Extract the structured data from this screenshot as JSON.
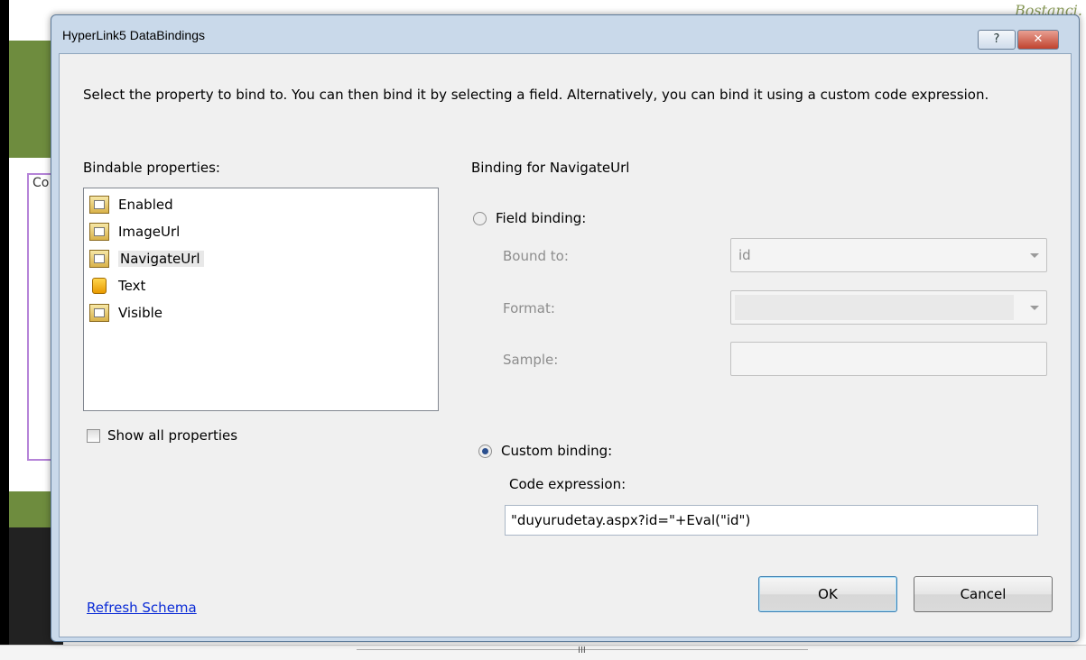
{
  "background": {
    "brand_fragment": "Bostanci.",
    "panel_fragment": "Co",
    "scroll_grip": "III"
  },
  "dialog": {
    "title": "HyperLink5 DataBindings",
    "help_glyph": "?",
    "close_glyph": "✕",
    "intro": "Select the property to bind to. You can then bind it by selecting a field. Alternatively, you can bind it using a custom code expression.",
    "bindable_label": "Bindable properties:",
    "properties": [
      {
        "label": "Enabled",
        "icon": "property-icon"
      },
      {
        "label": "ImageUrl",
        "icon": "property-icon"
      },
      {
        "label": "NavigateUrl",
        "icon": "property-icon",
        "selected": true
      },
      {
        "label": "Text",
        "icon": "field-icon"
      },
      {
        "label": "Visible",
        "icon": "property-icon"
      }
    ],
    "show_all_label": "Show all properties",
    "binding_for": "Binding for NavigateUrl",
    "field_binding_label": "Field binding:",
    "bound_to_label": "Bound to:",
    "bound_to_value": "id",
    "format_label": "Format:",
    "format_value": "",
    "sample_label": "Sample:",
    "custom_binding_label": "Custom binding:",
    "code_expression_label": "Code expression:",
    "code_expression_value": "\"duyurudetay.aspx?id=\"+Eval(\"id\")",
    "refresh_link": "Refresh Schema",
    "ok_label": "OK",
    "cancel_label": "Cancel"
  }
}
